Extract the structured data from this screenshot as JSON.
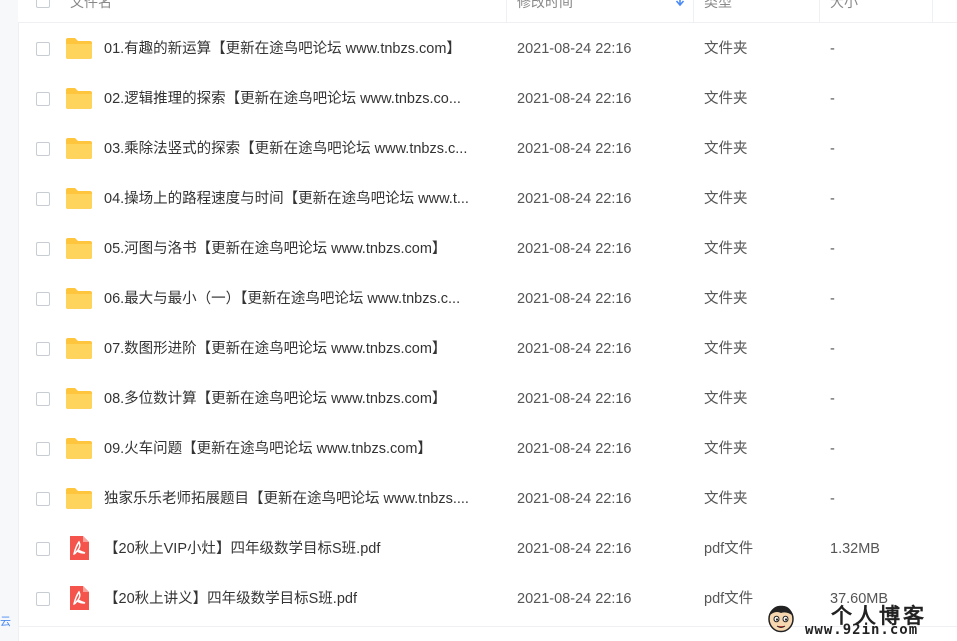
{
  "colors": {
    "folder": "#ffc53d",
    "pdf": "#f4544b",
    "accent": "#4a8af4"
  },
  "header": {
    "name_label": "文件名",
    "time_label": "修改时间",
    "type_label": "类型",
    "size_label": "大小"
  },
  "files": [
    {
      "icon": "folder-icon",
      "name": "01.有趣的新运算【更新在途鸟吧论坛 www.tnbzs.com】",
      "modified": "2021-08-24 22:16",
      "type": "文件夹",
      "size": "-"
    },
    {
      "icon": "folder-icon",
      "name": "02.逻辑推理的探索【更新在途鸟吧论坛 www.tnbzs.co...",
      "modified": "2021-08-24 22:16",
      "type": "文件夹",
      "size": "-"
    },
    {
      "icon": "folder-icon",
      "name": "03.乘除法竖式的探索【更新在途鸟吧论坛 www.tnbzs.c...",
      "modified": "2021-08-24 22:16",
      "type": "文件夹",
      "size": "-"
    },
    {
      "icon": "folder-icon",
      "name": "04.操场上的路程速度与时间【更新在途鸟吧论坛 www.t...",
      "modified": "2021-08-24 22:16",
      "type": "文件夹",
      "size": "-"
    },
    {
      "icon": "folder-icon",
      "name": "05.河图与洛书【更新在途鸟吧论坛 www.tnbzs.com】",
      "modified": "2021-08-24 22:16",
      "type": "文件夹",
      "size": "-"
    },
    {
      "icon": "folder-icon",
      "name": "06.最大与最小（一）【更新在途鸟吧论坛 www.tnbzs.c...",
      "modified": "2021-08-24 22:16",
      "type": "文件夹",
      "size": "-"
    },
    {
      "icon": "folder-icon",
      "name": "07.数图形进阶【更新在途鸟吧论坛 www.tnbzs.com】",
      "modified": "2021-08-24 22:16",
      "type": "文件夹",
      "size": "-"
    },
    {
      "icon": "folder-icon",
      "name": "08.多位数计算【更新在途鸟吧论坛 www.tnbzs.com】",
      "modified": "2021-08-24 22:16",
      "type": "文件夹",
      "size": "-"
    },
    {
      "icon": "folder-icon",
      "name": "09.火车问题【更新在途鸟吧论坛 www.tnbzs.com】",
      "modified": "2021-08-24 22:16",
      "type": "文件夹",
      "size": "-"
    },
    {
      "icon": "folder-icon",
      "name": "独家乐乐老师拓展题目【更新在途鸟吧论坛 www.tnbzs....",
      "modified": "2021-08-24 22:16",
      "type": "文件夹",
      "size": "-"
    },
    {
      "icon": "pdf-icon",
      "name": "【20秋上VIP小灶】四年级数学目标S班.pdf",
      "modified": "2021-08-24 22:16",
      "type": "pdf文件",
      "size": "1.32MB"
    },
    {
      "icon": "pdf-icon",
      "name": "【20秋上讲义】四年级数学目标S班.pdf",
      "modified": "2021-08-24 22:16",
      "type": "pdf文件",
      "size": "37.60MB"
    }
  ],
  "watermark": {
    "title": "个人博客",
    "url": "www.92in.com"
  },
  "gutter_text": "云"
}
